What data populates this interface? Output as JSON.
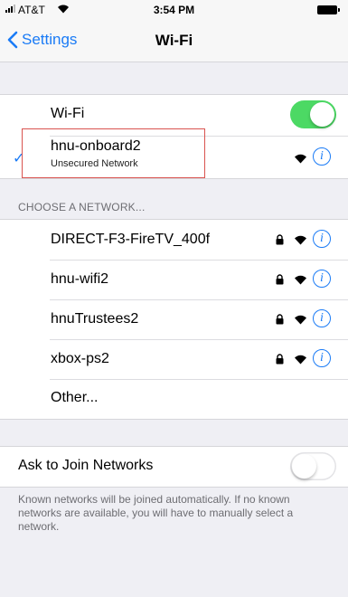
{
  "status_bar": {
    "carrier": "AT&T",
    "time": "3:54 PM"
  },
  "nav": {
    "back_label": "Settings",
    "title": "Wi-Fi"
  },
  "wifi_toggle": {
    "label": "Wi-Fi",
    "on": true
  },
  "connected": {
    "name": "hnu-onboard2",
    "subtitle": "Unsecured Network"
  },
  "section_header": "CHOOSE A NETWORK...",
  "networks": [
    {
      "name": "DIRECT-F3-FireTV_400f",
      "locked": true
    },
    {
      "name": "hnu-wifi2",
      "locked": true
    },
    {
      "name": "hnuTrustees2",
      "locked": true
    },
    {
      "name": "xbox-ps2",
      "locked": true
    }
  ],
  "other_label": "Other...",
  "ask_to_join": {
    "label": "Ask to Join Networks",
    "on": false
  },
  "footer_text": "Known networks will be joined automatically. If no known networks are available, you will have to manually select a network.",
  "colors": {
    "accent": "#1a7bf6",
    "toggle_on": "#4cd964",
    "highlight": "#d9534f"
  },
  "icons": [
    "wifi-icon",
    "lock-icon",
    "info-icon",
    "checkmark-icon",
    "chevron-left-icon"
  ]
}
